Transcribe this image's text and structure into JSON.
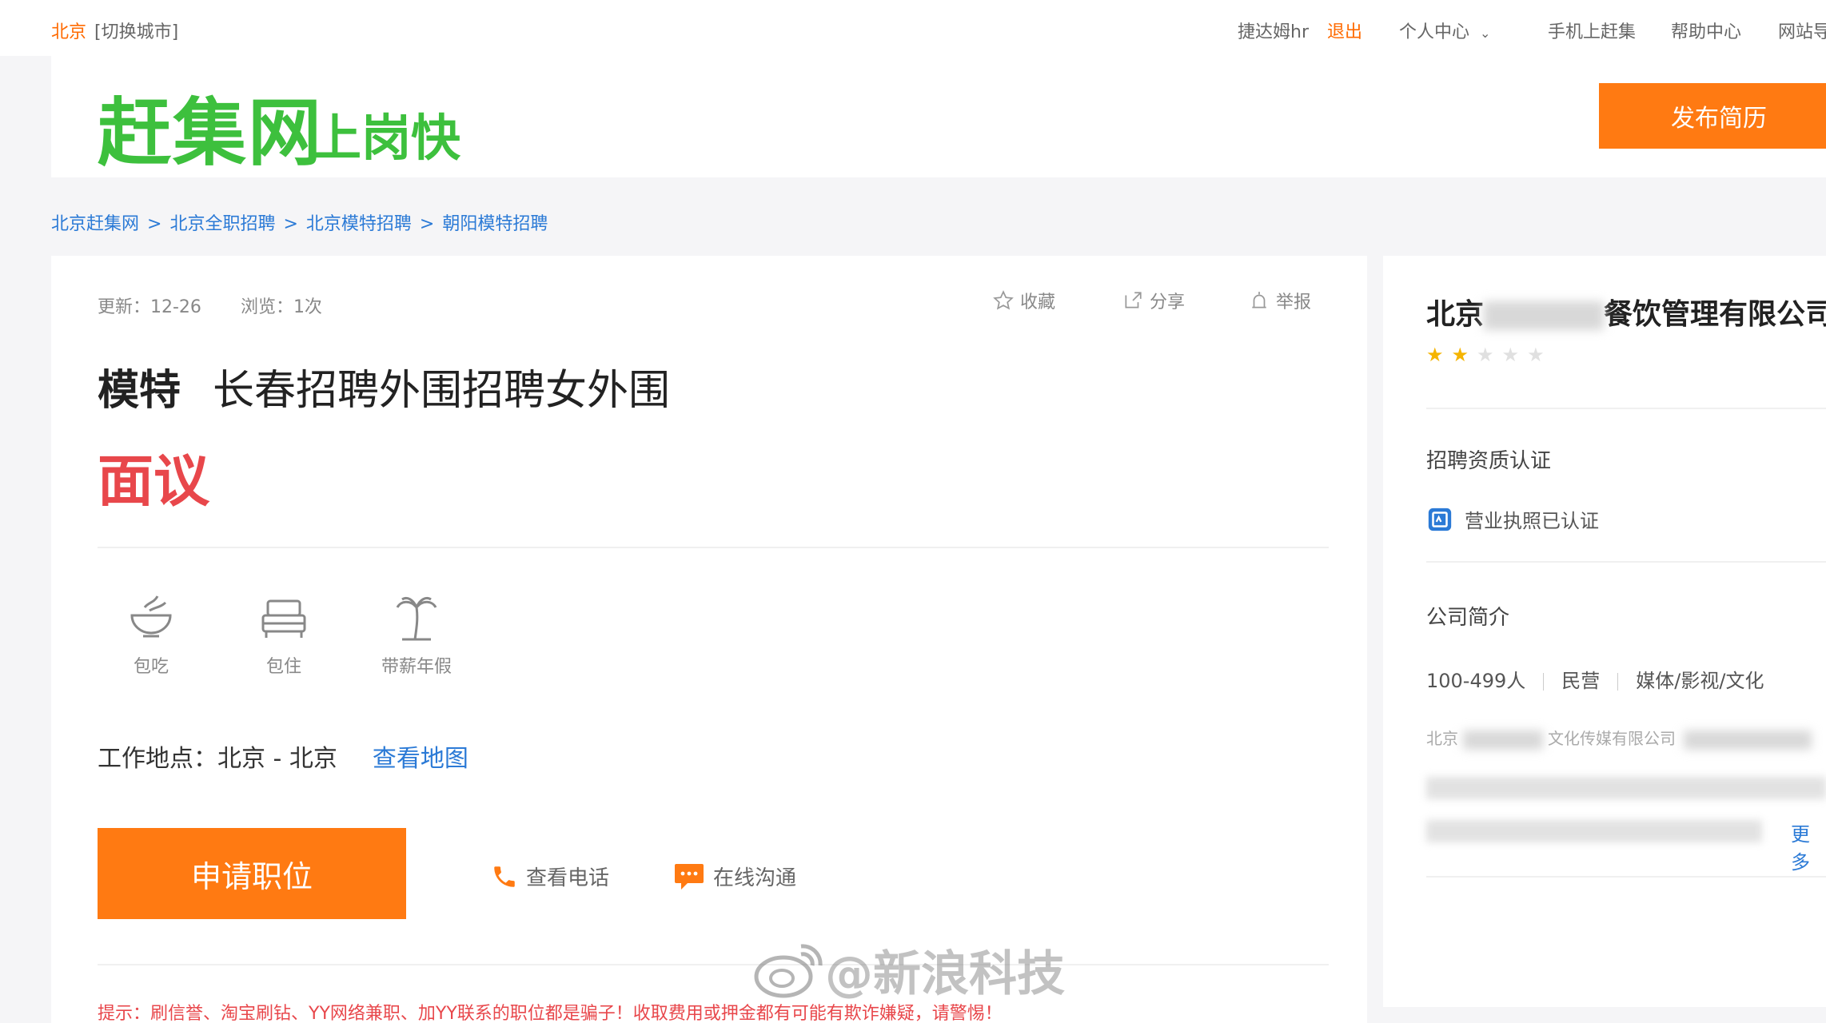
{
  "topbar": {
    "city": "北京",
    "switch_city": "[切换城市]",
    "username": "捷达姆hr",
    "logout": "退出",
    "personal_center": "个人中心",
    "mobile": "手机上赶集",
    "help": "帮助中心",
    "site_nav": "网站导"
  },
  "header": {
    "logo_main": "赶集网",
    "logo_sub": "上岗快",
    "publish_resume": "发布简历"
  },
  "breadcrumb": [
    "北京赶集网",
    "北京全职招聘",
    "北京模特招聘",
    "朝阳模特招聘"
  ],
  "breadcrumb_sep": ">",
  "job": {
    "updated": "更新：12-26",
    "views": "浏览：1次",
    "favorite": "收藏",
    "share": "分享",
    "report": "举报",
    "category": "模特",
    "title": "长春招聘外围招聘女外围",
    "salary": "面议",
    "benefits": [
      {
        "icon": "bowl-icon",
        "label": "包吃"
      },
      {
        "icon": "bed-icon",
        "label": "包住"
      },
      {
        "icon": "palm-tree-icon",
        "label": "带薪年假"
      }
    ],
    "location_label": "工作地点：",
    "location": "北京 - 北京",
    "view_map": "查看地图",
    "apply": "申请职位",
    "view_phone": "查看电话",
    "online_chat": "在线沟通",
    "tip": "提示：刷信誉、淘宝刷钻、YY网络兼职、加YY联系的职位都是骗子！收取费用或押金都有可能有欺诈嫌疑，请警惕！"
  },
  "company": {
    "name_prefix": "北京",
    "name_suffix": "餐饮管理有限公司",
    "rating": 2,
    "rating_max": 5,
    "cert_title": "招聘资质认证",
    "cert": "营业执照已认证",
    "intro_title": "公司简介",
    "size": "100-499人",
    "type": "民营",
    "industry": "媒体/影视/文化",
    "desc_fragment": "北京",
    "desc_fragment2": "文化传媒有限公司",
    "more": "更多"
  },
  "watermark": "@新浪科技",
  "colors": {
    "brand_green": "#3dc03d",
    "accent_orange": "#ff7a12",
    "salary_red": "#e8474b",
    "link_blue": "#2b7ad6",
    "star_gold": "#f5b400"
  }
}
